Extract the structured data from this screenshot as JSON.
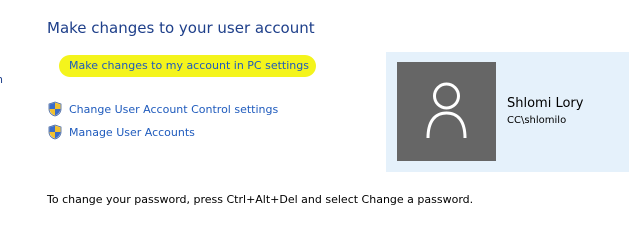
{
  "header": {
    "title": "Make changes to your user account"
  },
  "edge_mark": "n",
  "links": {
    "pc_settings": "Make changes to my account in PC settings",
    "uac_settings": "Change User Account Control settings",
    "manage_accounts": "Manage User Accounts"
  },
  "icons": {
    "shield": "uac-shield-icon",
    "avatar": "user-silhouette-icon"
  },
  "user_card": {
    "name": "Shlomi Lory",
    "account": "CC\\shlomilo"
  },
  "note": "To change your password, press Ctrl+Alt+Del and select Change a password.",
  "colors": {
    "title": "#1e3f8a",
    "link": "#1f5bbd",
    "highlight": "#f4f41c",
    "card_bg": "#e5f1fb",
    "avatar_bg": "#666666"
  }
}
